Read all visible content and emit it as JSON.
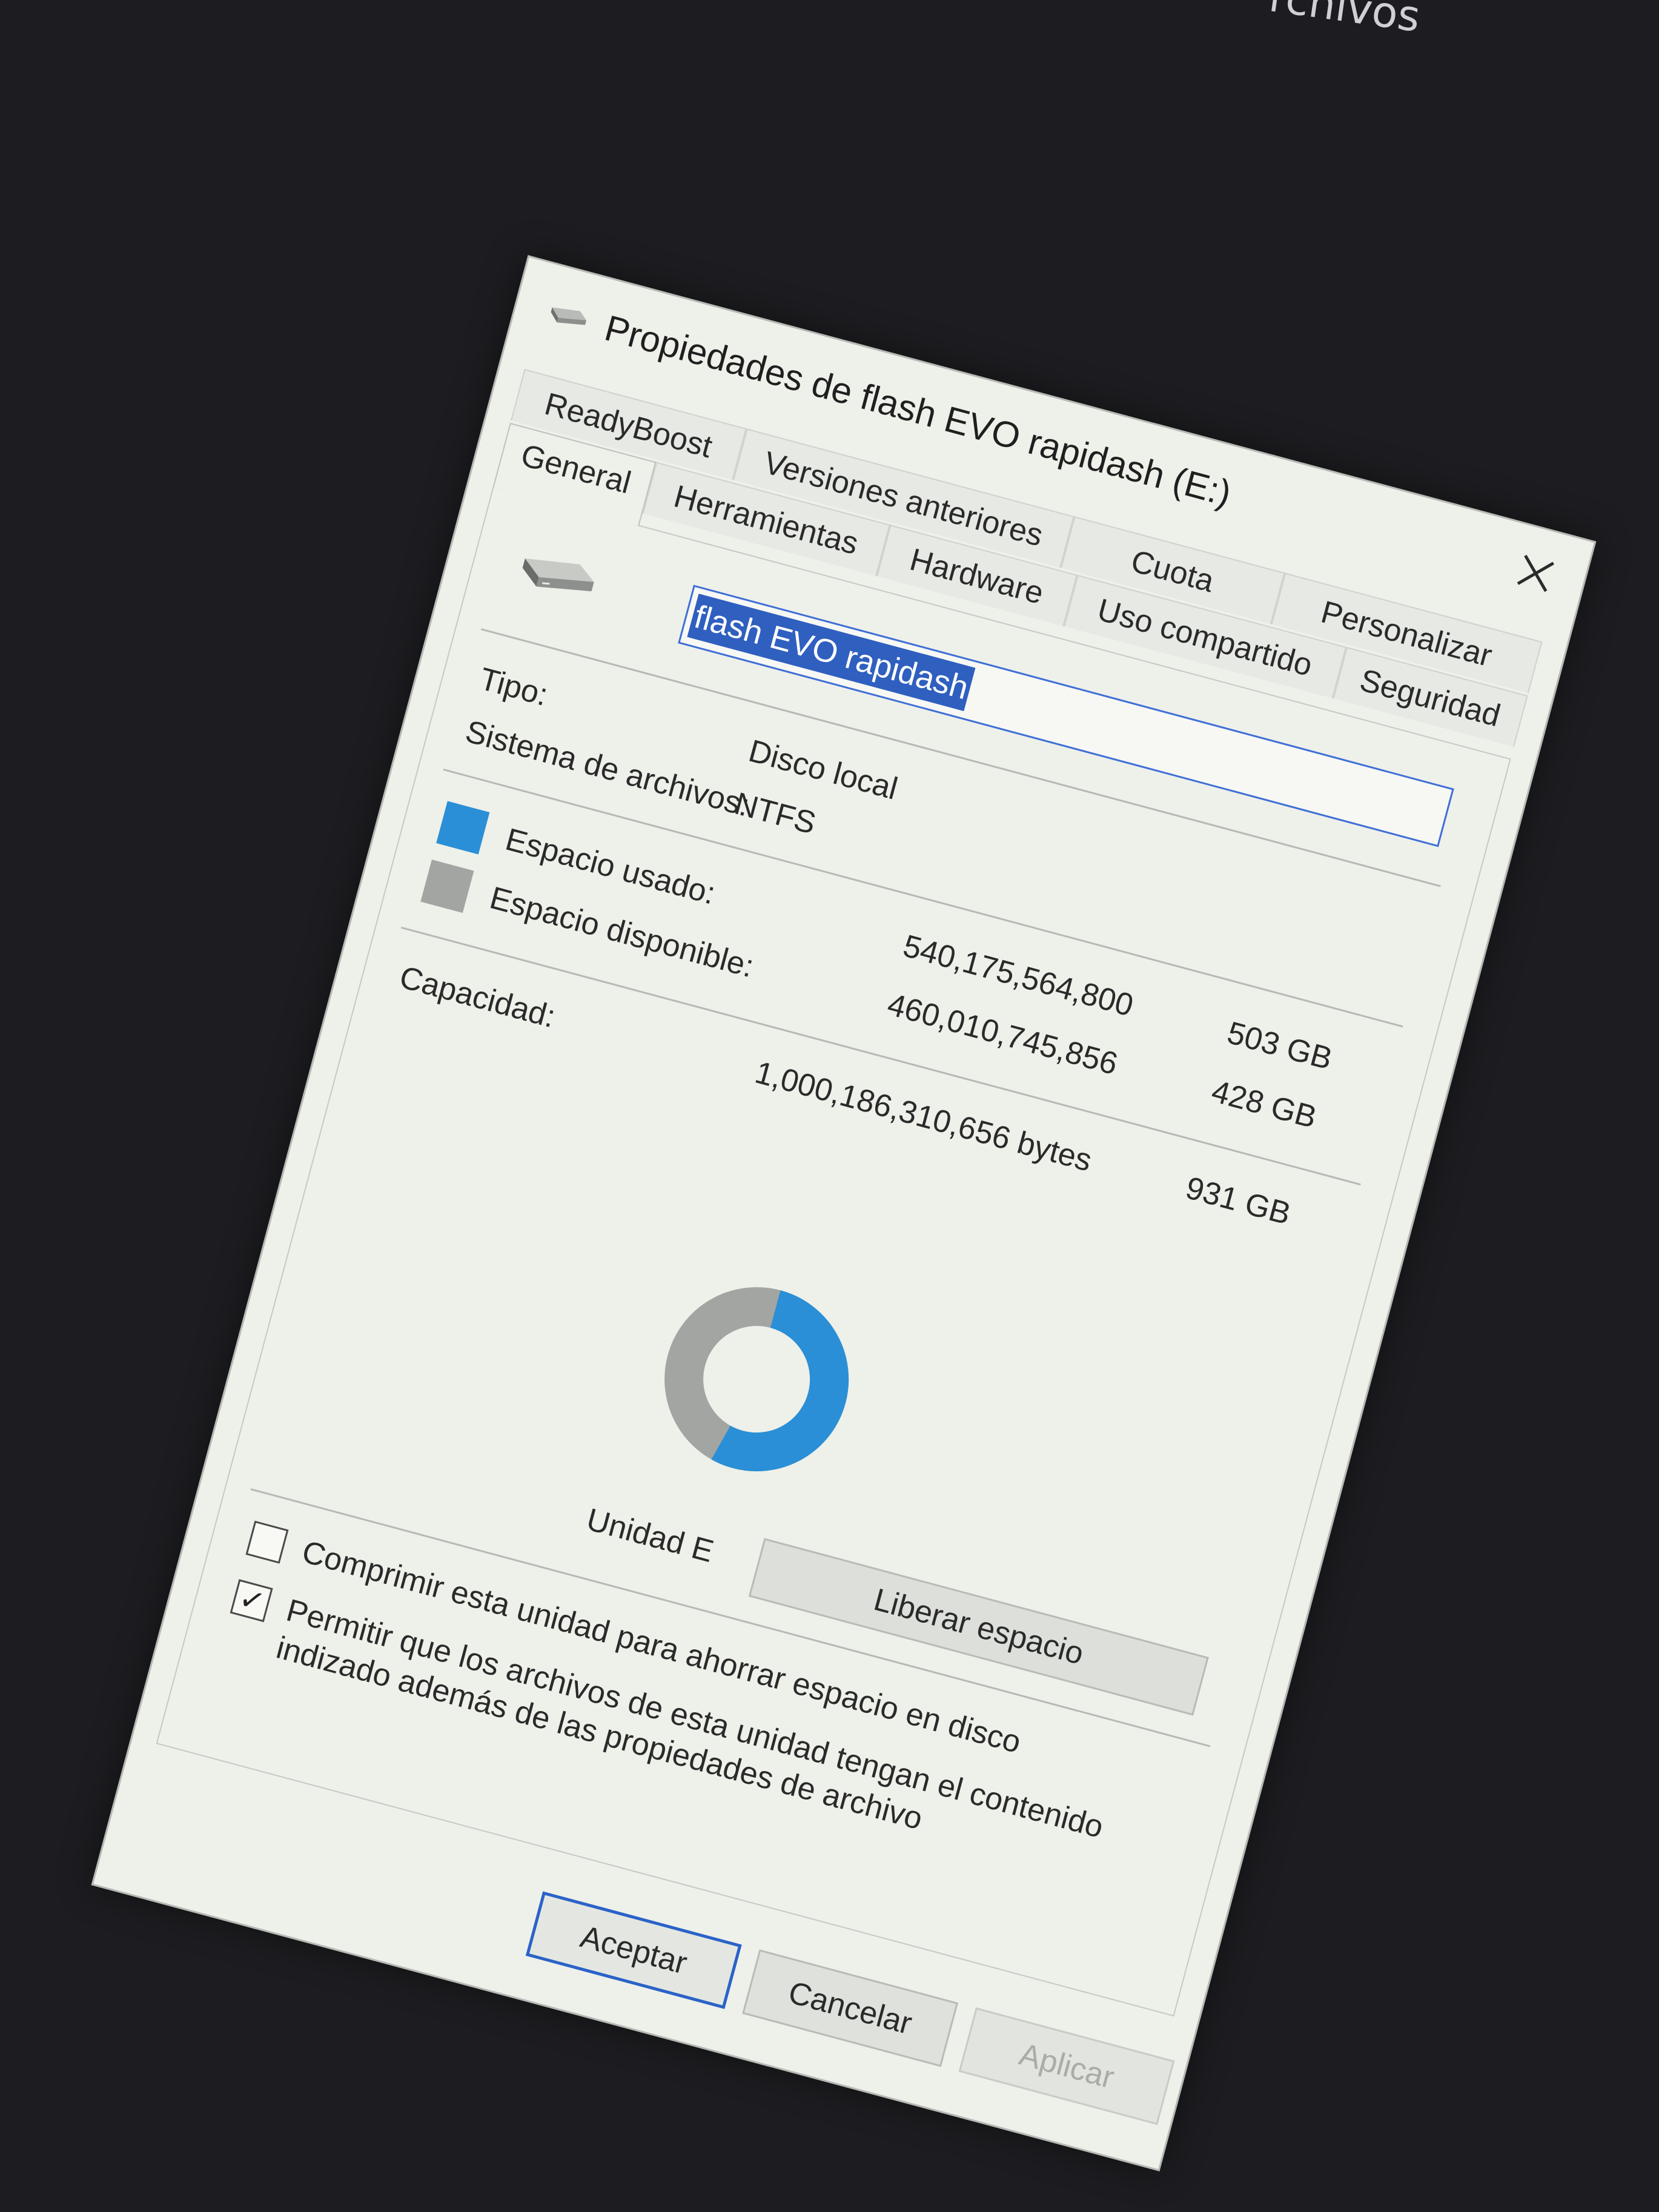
{
  "background_text": "rchivos",
  "window": {
    "title": "Propiedades de flash EVO rapidash (E:)",
    "title_icon": "drive-icon",
    "close_icon": "close-icon"
  },
  "tabs": {
    "row_back": [
      "ReadyBoost",
      "Versiones anteriores",
      "Cuota",
      "Personalizar"
    ],
    "row_front": [
      "General",
      "Herramientas",
      "Hardware",
      "Uso compartido",
      "Seguridad"
    ],
    "active": "General"
  },
  "general": {
    "drive_name": "flash EVO rapidash",
    "type_label": "Tipo:",
    "type_value": "Disco local",
    "fs_label": "Sistema de archivos:",
    "fs_value": "NTFS",
    "used_label": "Espacio usado:",
    "used_bytes": "540,175,564,800",
    "used_gb": "503 GB",
    "free_label": "Espacio disponible:",
    "free_bytes": "460,010,745,856",
    "free_gb": "428 GB",
    "capacity_label": "Capacidad:",
    "capacity_bytes": "1,000,186,310,656 bytes",
    "capacity_gb": "931 GB",
    "drive_caption": "Unidad E",
    "cleanup_button": "Liberar espacio",
    "used_fraction": 0.54,
    "used_color": "#2a8fd6",
    "free_color": "#a3a5a2"
  },
  "options": {
    "compress_label": "Comprimir esta unidad para ahorrar espacio en disco",
    "compress_checked": false,
    "index_label": "Permitir que los archivos de esta unidad tengan el contenido indizado además de las propiedades de archivo",
    "index_checked": true
  },
  "buttons": {
    "ok": "Aceptar",
    "cancel": "Cancelar",
    "apply": "Aplicar"
  }
}
